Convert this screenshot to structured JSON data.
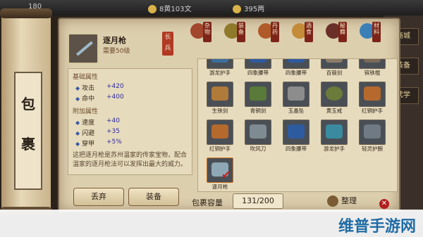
{
  "topbar": {
    "left": "180",
    "center": "8黄103文",
    "right": "395两"
  },
  "bg_menu": [
    "商城",
    "装备",
    "武学"
  ],
  "scroll_title": [
    "包",
    "裹"
  ],
  "item": {
    "name": "逐月枪",
    "requirement": "需要50级",
    "type_tag": "长兵",
    "sections": {
      "base_title": "基础属性",
      "bonus_title": "附加属性"
    },
    "base": [
      {
        "k": "攻击",
        "v": "+420"
      },
      {
        "k": "命中",
        "v": "+400"
      }
    ],
    "bonus": [
      {
        "k": "速度",
        "v": "+40"
      },
      {
        "k": "闪避",
        "v": "+35"
      },
      {
        "k": "穿甲",
        "v": "+5%"
      }
    ],
    "description": "这把逐月枪是苏州温家的传家宝物，配合温家的逐月枪法可以发挥出最大的威力。"
  },
  "buttons": {
    "discard": "丢弃",
    "equip": "装备",
    "sort": "整理"
  },
  "tabs": [
    {
      "label": "杂物",
      "color": "#a2472d"
    },
    {
      "label": "装备",
      "color": "#8f7a2c"
    },
    {
      "label": "丹药",
      "color": "#b05a2a"
    },
    {
      "label": "酒食",
      "color": "#c48b38"
    },
    {
      "label": "秘籍",
      "color": "#6b2f2a"
    },
    {
      "label": "材料",
      "color": "#3a7fb8"
    }
  ],
  "grid": {
    "row0": [
      "游龙护手",
      "四象腰带",
      "四象腰带",
      "百锻剑",
      "镔铁棍"
    ],
    "row1": [
      "生铁剑",
      "青铜剑",
      "玉晶坠",
      "黄玉戒",
      "红铜护手"
    ],
    "row2": [
      "红铜护手",
      "吹风刀",
      "四象腰带",
      "游龙护手",
      "轻灵护腕"
    ],
    "row3": [
      "逐月枪"
    ]
  },
  "capacity": {
    "label": "包裹容量",
    "value": "131/200"
  },
  "footer": "维普手游网"
}
